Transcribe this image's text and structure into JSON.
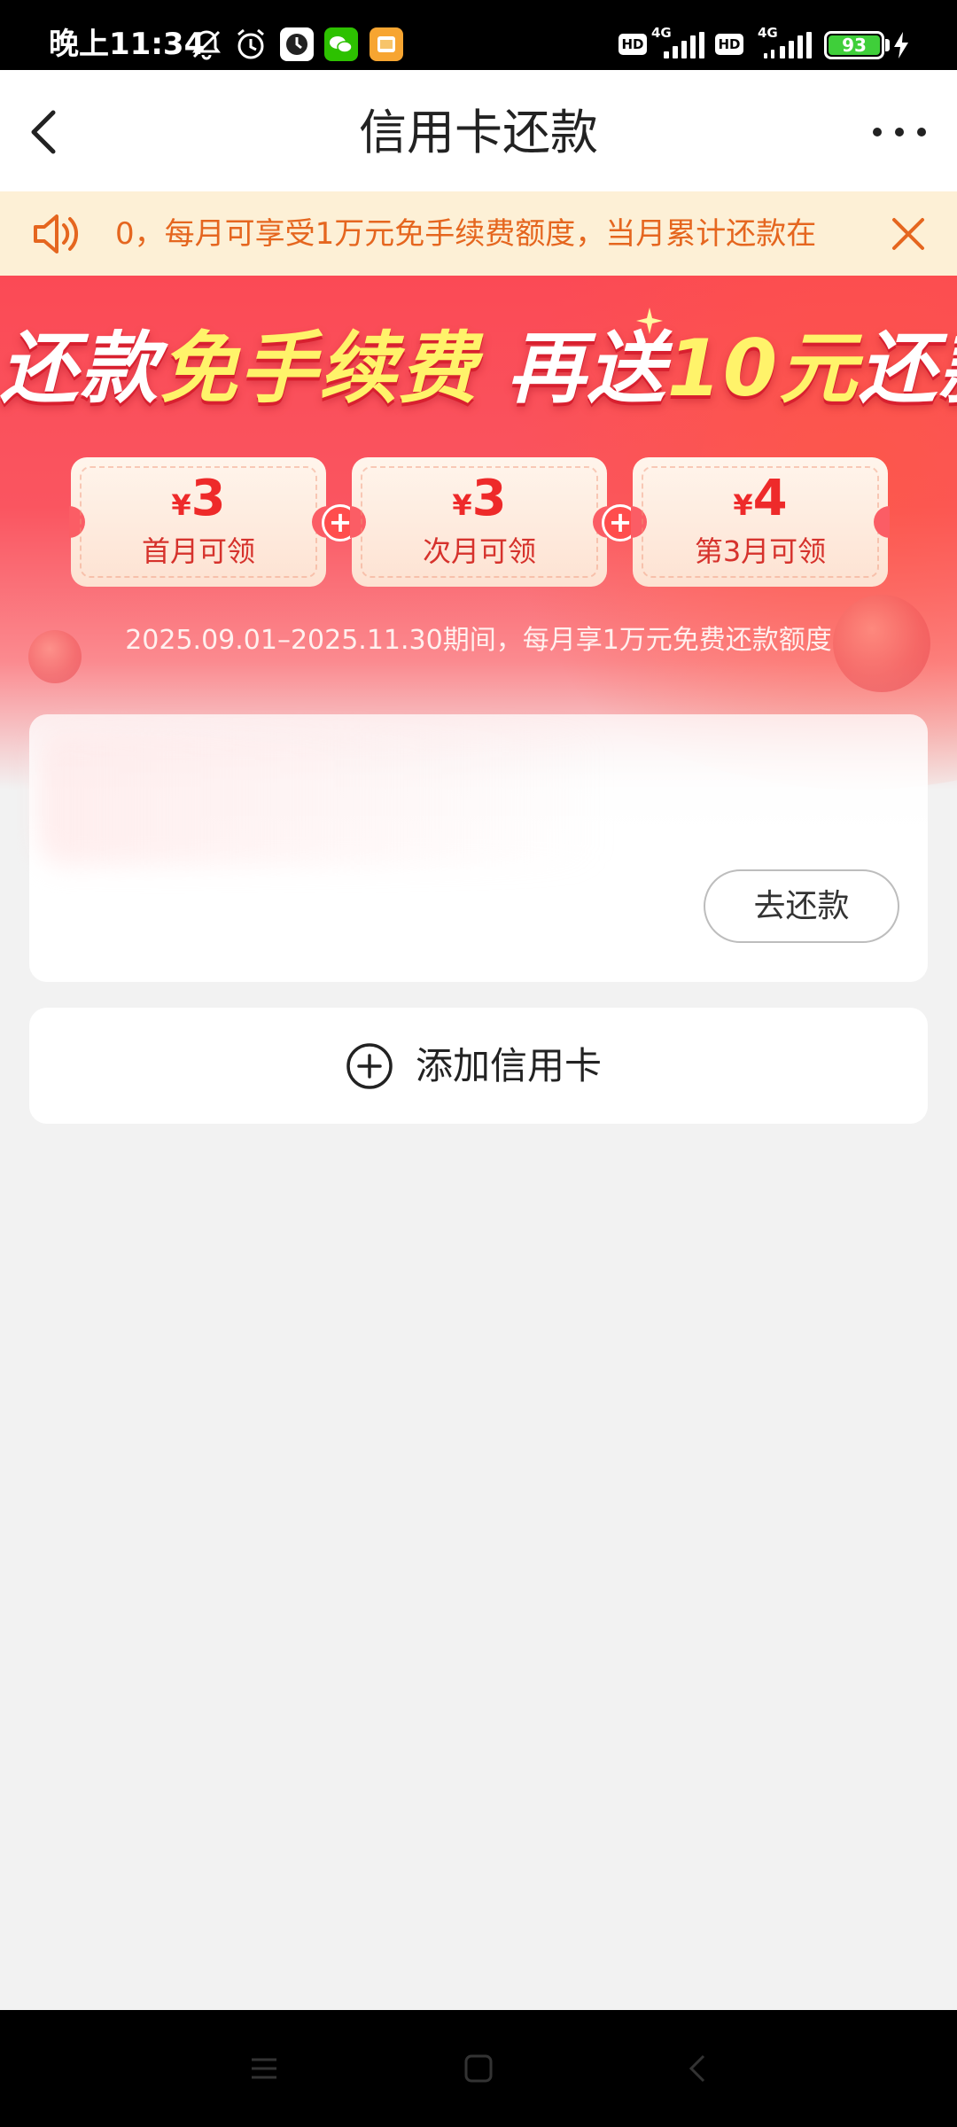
{
  "status_bar": {
    "time": "晚上11:34",
    "network_1": "4G",
    "network_2": "4G",
    "hd_1": "HD",
    "hd_2": "HD",
    "battery": "93"
  },
  "header": {
    "title": "信用卡还款"
  },
  "notice": {
    "text": "0，每月可享受1万元免手续费额度，当月累计还款在"
  },
  "banner": {
    "title_part1": "还款",
    "title_part2": "免手续费",
    "title_part3": "再送",
    "title_part4": "10元",
    "title_part5": "还款金",
    "coupons": [
      {
        "currency": "¥",
        "amount": "3",
        "label": "首月可领"
      },
      {
        "currency": "¥",
        "amount": "3",
        "label": "次月可领"
      },
      {
        "currency": "¥",
        "amount": "4",
        "label": "第3月可领"
      }
    ],
    "plus": "+",
    "period": "2025.09.01–2025.11.30期间，每月享1万元免费还款额度"
  },
  "card": {
    "repay_button": "去还款"
  },
  "add_card": {
    "label": "添加信用卡"
  },
  "colors": {
    "accent_red": "#fb4a55",
    "notice_bg": "#fdf0d6",
    "notice_text": "#e5661f",
    "coupon_text": "#ee2a2a"
  }
}
